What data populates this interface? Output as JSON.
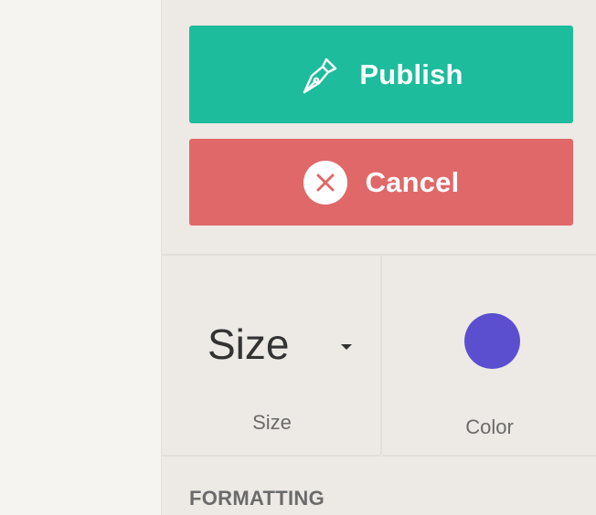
{
  "actions": {
    "publish_label": "Publish",
    "cancel_label": "Cancel"
  },
  "size_tile": {
    "value": "Size",
    "label": "Size"
  },
  "color_tile": {
    "label": "Color",
    "swatch": "#5b4fd0"
  },
  "sections": {
    "formatting_title": "FORMATTING"
  },
  "colors": {
    "publish_bg": "#1dbc9c",
    "cancel_bg": "#e06868",
    "panel_bg": "#ede9e5"
  },
  "icons": {
    "publish": "pen-nib-icon",
    "cancel": "close-circle-icon",
    "size_dropdown": "caret-down-icon"
  }
}
